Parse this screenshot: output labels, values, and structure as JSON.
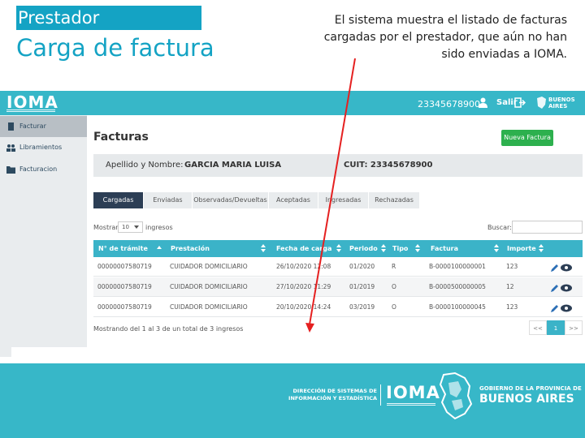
{
  "slide": {
    "tag": "Prestador",
    "title": "Carga de factura",
    "caption": "El sistema muestra el listado de facturas cargadas por el prestador, que aún no han sido enviadas a IOMA."
  },
  "header": {
    "logo": "IOMA",
    "user_id": "23345678900",
    "logout_label": "Salir",
    "province_logo": "BUENOS AIRES"
  },
  "sidebar": {
    "items": [
      {
        "label": "Facturar",
        "icon": "document-icon",
        "active": true
      },
      {
        "label": "Libramientos",
        "icon": "users-icon",
        "active": false
      },
      {
        "label": "Facturacion",
        "icon": "folder-icon",
        "active": false
      }
    ]
  },
  "main": {
    "title": "Facturas",
    "new_button": "Nueva Factura",
    "info": {
      "name_label": "Apellido y Nombre:",
      "name_value": "GARCIA MARIA LUISA",
      "cuit": "CUIT: 23345678900"
    },
    "tabs": [
      {
        "label": "Cargadas",
        "active": true
      },
      {
        "label": "Enviadas",
        "active": false
      },
      {
        "label": "Observadas/Devueltas",
        "active": false
      },
      {
        "label": "Aceptadas",
        "active": false
      },
      {
        "label": "Ingresadas",
        "active": false
      },
      {
        "label": "Rechazadas",
        "active": false
      }
    ],
    "show_label": "Mostrar",
    "show_value": "10",
    "show_suffix": "ingresos",
    "search_label": "Buscar:",
    "table": {
      "columns": [
        "N° de trámite",
        "Prestación",
        "Fecha de carga",
        "Periodo",
        "Tipo",
        "Factura",
        "Importe"
      ],
      "rows": [
        [
          "00000007580719",
          "CUIDADOR DOMICILIARIO",
          "26/10/2020 12:08",
          "01/2020",
          "R",
          "B-0000100000001",
          "123"
        ],
        [
          "00000007580719",
          "CUIDADOR DOMICILIARIO",
          "27/10/2020 11:29",
          "01/2019",
          "O",
          "B-0000500000005",
          "12"
        ],
        [
          "00000007580719",
          "CUIDADOR DOMICILIARIO",
          "20/10/2020 14:24",
          "03/2019",
          "O",
          "B-0000100000045",
          "123"
        ]
      ]
    },
    "footer_text": "Mostrando del 1 al 3 de un total de 3 ingresos",
    "pager": [
      "<<",
      "1",
      ">>"
    ]
  },
  "footer": {
    "direction_line1": "DIRECCIÓN DE SISTEMAS DE",
    "direction_line2": "INFORMACIÓN Y ESTADÍSTICA",
    "ioma": "IOMA",
    "gob_line": "GOBIERNO DE LA PROVINCIA DE",
    "ba_line": "BUENOS AIRES"
  },
  "colors": {
    "accent": "#37b7c8",
    "tag": "#14a3c4",
    "active_tab": "#2c3e55",
    "new_button": "#2db04e",
    "arrow": "#e52020"
  }
}
